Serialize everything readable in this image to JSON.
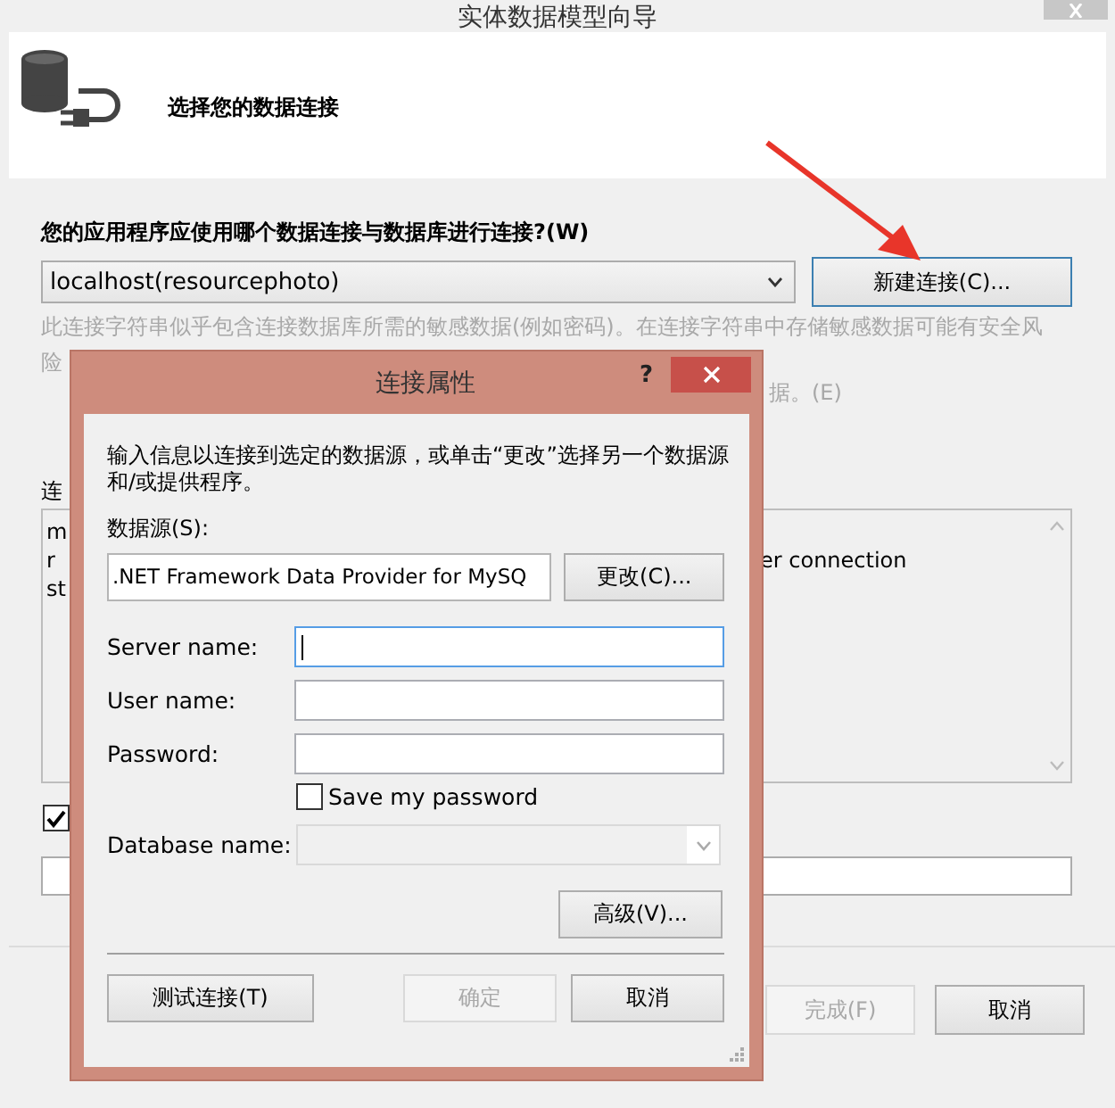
{
  "window": {
    "title": "实体数据模型向导"
  },
  "header": {
    "heading": "选择您的数据连接"
  },
  "connection": {
    "question": "您的应用程序应使用哪个数据连接与数据库进行连接?(W)",
    "value": "localhost(resourcephoto)",
    "new_button": "新建连接(C)..."
  },
  "warning": {
    "line_1": "此连接字符串似乎包含连接数据库所需的敏感数据(例如密码)。在连接字符串中存储敏感数据可能有安全风",
    "line_2": "险",
    "tail": "据。(E)"
  },
  "string_label": "连",
  "connection_string": {
    "left_lines": [
      "m",
      "r",
      "st"
    ],
    "right_text": "er connection"
  },
  "save_setting": {
    "checked": true
  },
  "footer": {
    "buttons": [
      {
        "label": "完成(F)",
        "disabled": true
      },
      {
        "label": "取消",
        "disabled": false
      }
    ]
  },
  "dialog": {
    "title": "连接属性",
    "help": "?",
    "intro": "输入信息以连接到选定的数据源，或单击“更改”选择另一个数据源和/或提供程序。",
    "source_label": "数据源(S):",
    "source_value": ".NET Framework Data Provider for MySQ",
    "change_button": "更改(C)...",
    "fields": [
      {
        "label": "Server name:",
        "focused": true
      },
      {
        "label": "User name:",
        "focused": false
      },
      {
        "label": "Password:",
        "focused": false
      }
    ],
    "save_password": {
      "label": "Save my password",
      "checked": false
    },
    "database": {
      "label": "Database name:",
      "disabled": true
    },
    "advanced_button": "高级(V)...",
    "buttons": [
      {
        "label": "测试连接(T)",
        "disabled": false
      },
      {
        "label": "确定",
        "disabled": true
      },
      {
        "label": "取消",
        "disabled": false
      }
    ]
  }
}
